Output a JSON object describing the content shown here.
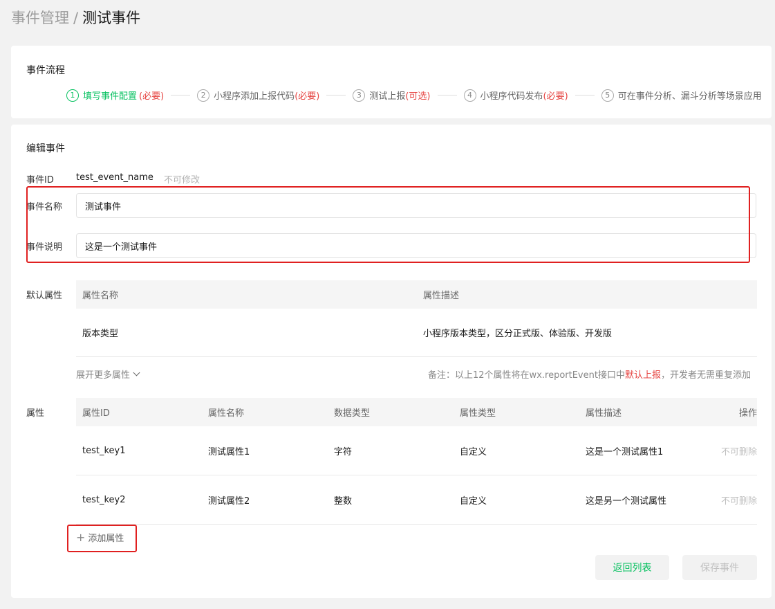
{
  "breadcrumb": {
    "parent": "事件管理",
    "separator": "/",
    "current": "测试事件"
  },
  "flow": {
    "title": "事件流程",
    "steps": [
      {
        "num": "1",
        "label": "填写事件配置",
        "tag": "(必要)",
        "active": true
      },
      {
        "num": "2",
        "label": "小程序添加上报代码",
        "tag": "(必要)"
      },
      {
        "num": "3",
        "label": "测试上报",
        "tag": "(可选)"
      },
      {
        "num": "4",
        "label": "小程序代码发布",
        "tag": "(必要)"
      },
      {
        "num": "5",
        "label": "可在事件分析、漏斗分析等场景应用",
        "tag": ""
      }
    ]
  },
  "edit": {
    "title": "编辑事件",
    "event_id": {
      "label": "事件ID",
      "value": "test_event_name",
      "note": "不可修改"
    },
    "event_name": {
      "label": "事件名称",
      "value": "测试事件"
    },
    "event_desc": {
      "label": "事件说明",
      "value": "这是一个测试事件"
    },
    "default_attrs": {
      "label": "默认属性",
      "columns": [
        "属性名称",
        "属性描述"
      ],
      "rows": [
        {
          "name": "版本类型",
          "desc": "小程序版本类型，区分正式版、体验版、开发版"
        }
      ],
      "expand_label": "展开更多属性",
      "remark_prefix": "备注：以上12个属性将在wx.reportEvent接口中",
      "remark_highlight": "默认上报",
      "remark_suffix": "，开发者无需重复添加"
    },
    "attrs": {
      "label": "属性",
      "columns": [
        "属性ID",
        "属性名称",
        "数据类型",
        "属性类型",
        "属性描述",
        "操作"
      ],
      "rows": [
        {
          "id": "test_key1",
          "name": "测试属性1",
          "dtype": "字符",
          "atype": "自定义",
          "desc": "这是一个测试属性1",
          "op": "不可删除"
        },
        {
          "id": "test_key2",
          "name": "测试属性2",
          "dtype": "整数",
          "atype": "自定义",
          "desc": "这是另一个测试属性",
          "op": "不可删除"
        }
      ],
      "add_label": "添加属性"
    },
    "buttons": {
      "back": "返回列表",
      "save": "保存事件"
    }
  },
  "colors": {
    "accent": "#07c160",
    "danger": "#e64340",
    "highlight": "#e02020"
  },
  "icons": {
    "expand": "chevron-down-icon",
    "add": "plus-icon"
  }
}
